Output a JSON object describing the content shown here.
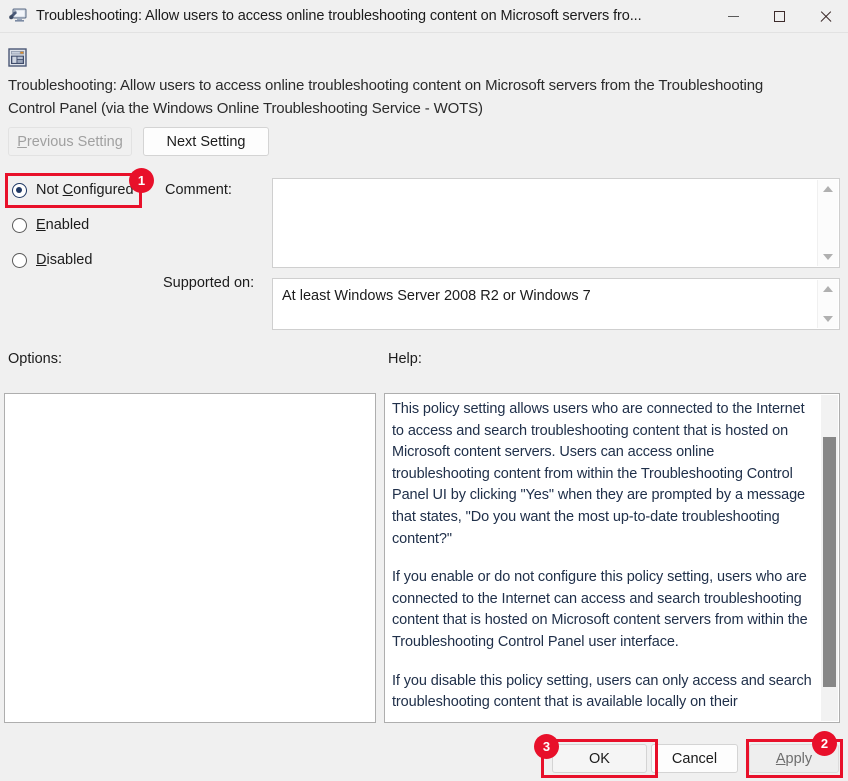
{
  "window": {
    "title": "Troubleshooting: Allow users to access online troubleshooting content on Microsoft servers fro...",
    "icon": "troubleshooting-monitor-icon",
    "controls": {
      "minimize": "minimize-icon",
      "maximize": "maximize-icon",
      "close": "close-icon"
    }
  },
  "policy": {
    "icon": "group-policy-setting-icon",
    "title": "Troubleshooting: Allow users to access online troubleshooting content on Microsoft servers from the Troubleshooting Control Panel (via the Windows Online Troubleshooting Service - WOTS)"
  },
  "nav": {
    "previous_label": "Previous Setting",
    "previous_enabled": false,
    "next_label": "Next Setting",
    "next_enabled": true
  },
  "state": {
    "options": [
      {
        "label": "Not Configured",
        "selected": true
      },
      {
        "label": "Enabled",
        "selected": false
      },
      {
        "label": "Disabled",
        "selected": false
      }
    ]
  },
  "comment": {
    "label": "Comment:",
    "value": "",
    "placeholder": ""
  },
  "supported": {
    "label": "Supported on:",
    "value": "At least Windows Server 2008 R2 or Windows 7"
  },
  "panels": {
    "options_label": "Options:",
    "options_content": "",
    "help_label": "Help:",
    "help_paragraphs": [
      "This policy setting allows users who are connected to the Internet to access and search troubleshooting content that is hosted on Microsoft content servers. Users can access online troubleshooting content from within the Troubleshooting Control Panel UI by clicking \"Yes\" when they are prompted by a message that states, \"Do you want the most up-to-date troubleshooting content?\"",
      "If you enable or do not configure this policy setting, users who are connected to the Internet can access and search troubleshooting content that is hosted on Microsoft content servers from within the Troubleshooting Control Panel user interface.",
      "If you disable this policy setting, users can only access and search troubleshooting content that is available locally on their"
    ]
  },
  "footer": {
    "ok_label": "OK",
    "cancel_label": "Cancel",
    "apply_label": "Apply",
    "apply_enabled": false
  },
  "annotations": {
    "accent_color": "#e8102a",
    "badges": [
      {
        "number": "1",
        "target": "not-configured-radio"
      },
      {
        "number": "2",
        "target": "apply-button"
      },
      {
        "number": "3",
        "target": "ok-button"
      }
    ]
  }
}
